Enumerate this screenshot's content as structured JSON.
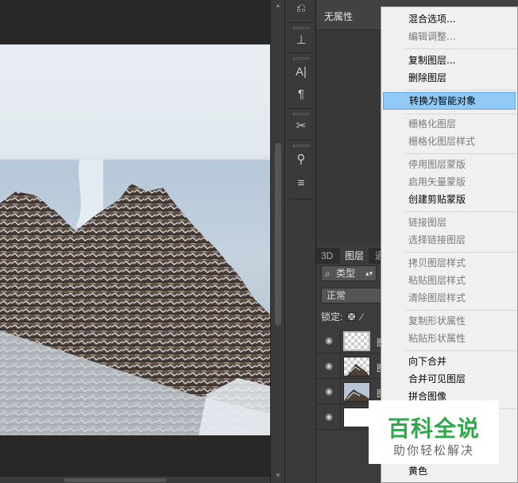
{
  "properties_panel": {
    "title": "无属性"
  },
  "layers_panel": {
    "tabs": [
      "3D",
      "图层",
      "通"
    ],
    "filter_label": "类型",
    "blend_mode": "正常",
    "lock_label": "锁定:",
    "layers": [
      {
        "visible": true,
        "name": "图",
        "thumb": "transparent-selected"
      },
      {
        "visible": true,
        "name": "图",
        "thumb": "transparent-mountain"
      },
      {
        "visible": true,
        "name": "图",
        "thumb": "mountain-photo"
      },
      {
        "visible": true,
        "name": "",
        "thumb": "white"
      }
    ]
  },
  "context_menu": {
    "groups": [
      [
        {
          "label": "混合选项...",
          "enabled": true
        },
        {
          "label": "编辑调整...",
          "enabled": false
        }
      ],
      [
        {
          "label": "复制图层...",
          "enabled": true
        },
        {
          "label": "删除图层",
          "enabled": true
        }
      ],
      [
        {
          "label": "转换为智能对象",
          "enabled": true,
          "highlighted": true
        }
      ],
      [
        {
          "label": "栅格化图层",
          "enabled": false
        },
        {
          "label": "栅格化图层样式",
          "enabled": false
        }
      ],
      [
        {
          "label": "停用图层蒙版",
          "enabled": false
        },
        {
          "label": "启用矢量蒙版",
          "enabled": false
        },
        {
          "label": "创建剪贴蒙版",
          "enabled": true
        }
      ],
      [
        {
          "label": "链接图层",
          "enabled": false
        },
        {
          "label": "选择链接图层",
          "enabled": false
        }
      ],
      [
        {
          "label": "拷贝图层样式",
          "enabled": false
        },
        {
          "label": "粘贴图层样式",
          "enabled": false
        },
        {
          "label": "清除图层样式",
          "enabled": false
        }
      ],
      [
        {
          "label": "复制形状属性",
          "enabled": false
        },
        {
          "label": "粘贴形状属性",
          "enabled": false
        }
      ],
      [
        {
          "label": "向下合并",
          "enabled": true
        },
        {
          "label": "合并可见图层",
          "enabled": true
        },
        {
          "label": "拼合图像",
          "enabled": true
        }
      ],
      [
        {
          "label": "黄色",
          "enabled": true
        }
      ]
    ]
  },
  "watermark": {
    "title": "百科全说",
    "subtitle": "助你轻松解决"
  },
  "colors": {
    "menu_highlight": "#91c9f7",
    "panel_bg": "#3c3c3c",
    "watermark_green": "#2ea84a"
  }
}
